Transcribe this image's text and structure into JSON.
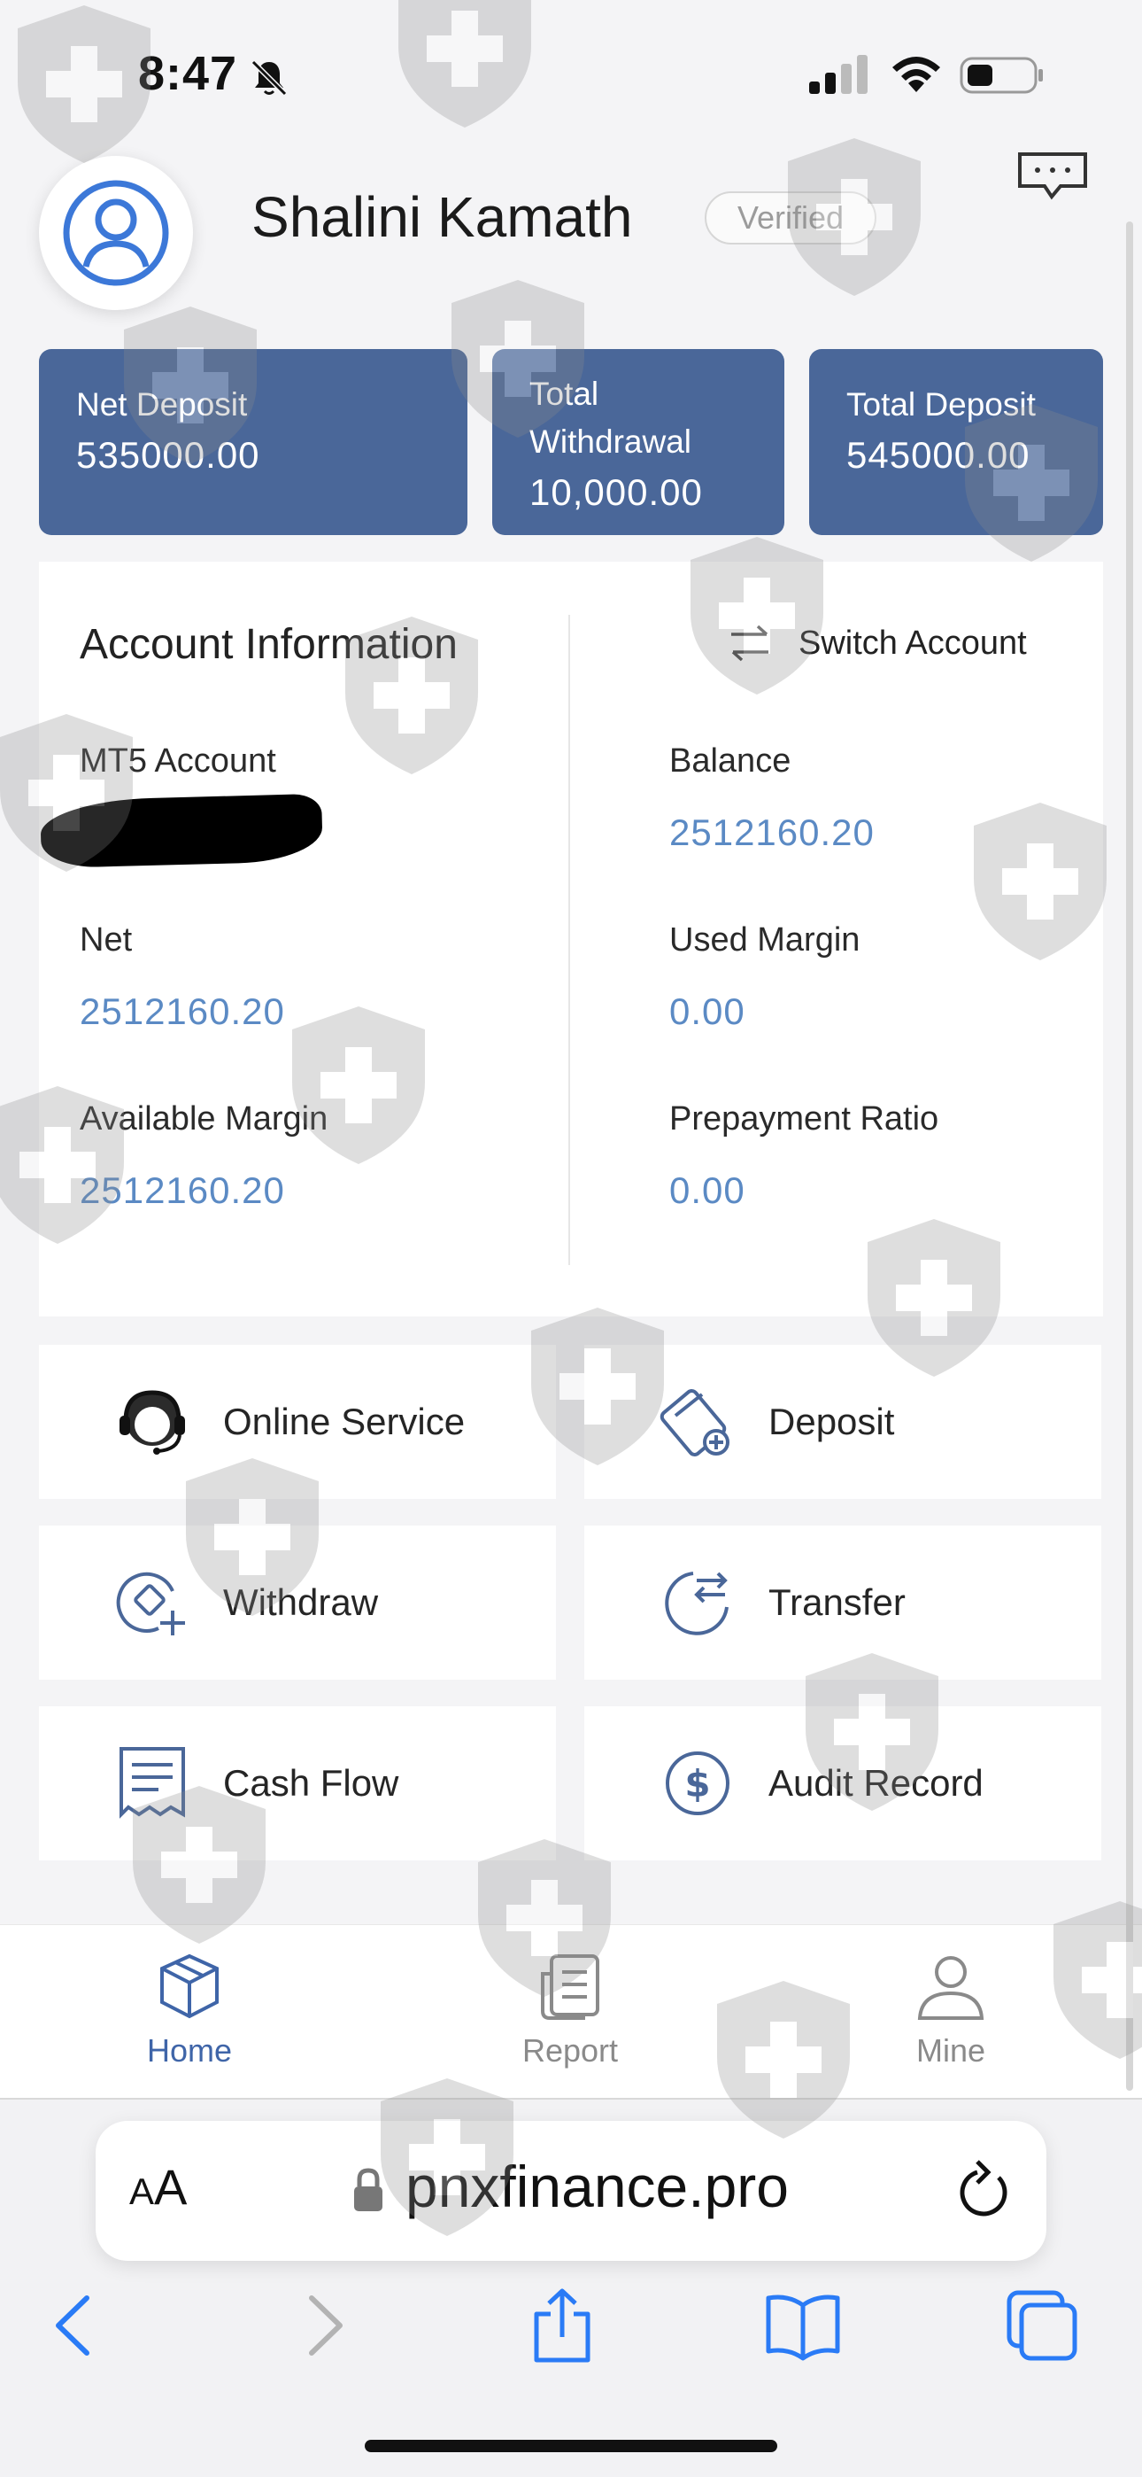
{
  "status_bar": {
    "time": "8:47"
  },
  "header": {
    "user_name": "Shalini Kamath",
    "verified_label": "Verified"
  },
  "stats": [
    {
      "label": "Net Deposit",
      "value": "535000.00"
    },
    {
      "label": "Total Withdrawal",
      "value": "10,000.00"
    },
    {
      "label": "Total Deposit",
      "value": "545000.00"
    }
  ],
  "account_info": {
    "title": "Account Information",
    "switch_label": "Switch Account",
    "mt5_label": "MT5 Account",
    "balance_label": "Balance",
    "balance_value": "2512160.20",
    "net_label": "Net",
    "net_value": "2512160.20",
    "used_margin_label": "Used Margin",
    "used_margin_value": "0.00",
    "available_margin_label": "Available Margin",
    "available_margin_value": "2512160.20",
    "prepayment_label": "Prepayment Ratio",
    "prepayment_value": "0.00"
  },
  "actions": [
    {
      "label": "Online Service",
      "icon": "headset-icon"
    },
    {
      "label": "Deposit",
      "icon": "card-plus-icon"
    },
    {
      "label": "Withdraw",
      "icon": "withdraw-icon"
    },
    {
      "label": "Transfer",
      "icon": "transfer-icon"
    },
    {
      "label": "Cash Flow",
      "icon": "receipt-icon"
    },
    {
      "label": "Audit Record",
      "icon": "dollar-circle-icon"
    }
  ],
  "tabs": [
    {
      "label": "Home",
      "icon": "box-icon",
      "active": true
    },
    {
      "label": "Report",
      "icon": "document-icon",
      "active": false
    },
    {
      "label": "Mine",
      "icon": "person-icon",
      "active": false
    }
  ],
  "browser": {
    "aa_large": "A",
    "aa_small": "A",
    "url": "pnxfinance.pro"
  },
  "colors": {
    "accent": "#4a6799",
    "value_blue": "#5b8ac4",
    "active_tab": "#3f65a8"
  }
}
